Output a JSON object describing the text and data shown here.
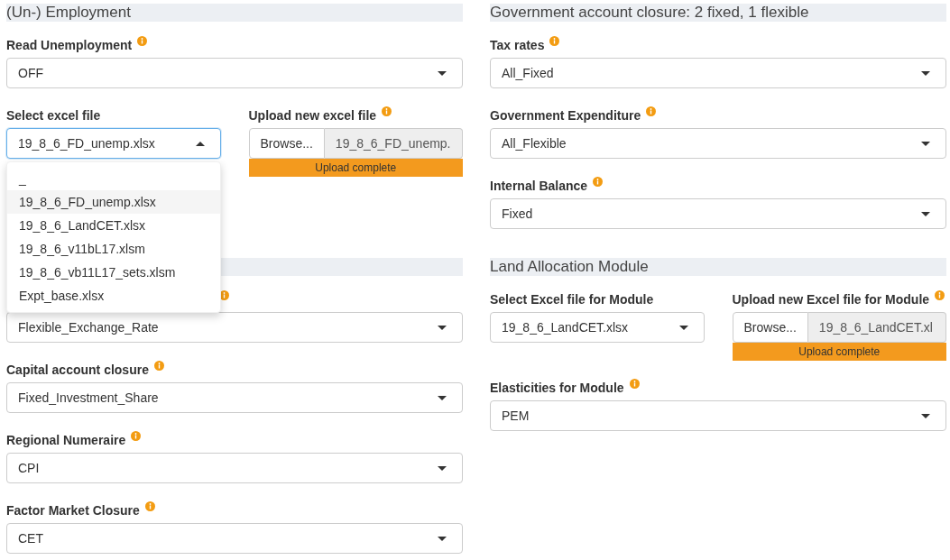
{
  "columns": [
    {
      "sections": [
        {
          "title": "(Un-) Employment",
          "rows": [
            [
              {
                "kind": "select",
                "label": "Read Unemployment",
                "info": true,
                "value": "OFF",
                "open": false
              }
            ],
            [
              {
                "kind": "select",
                "label": "Select excel file",
                "info": false,
                "value": "19_8_6_FD_unemp.xlsx",
                "open": true,
                "options": [
                  {
                    "label": "_",
                    "selected": false
                  },
                  {
                    "label": "19_8_6_FD_unemp.xlsx",
                    "selected": true
                  },
                  {
                    "label": "19_8_6_LandCET.xlsx",
                    "selected": false
                  },
                  {
                    "label": "19_8_6_v11bL17.xlsm",
                    "selected": false
                  },
                  {
                    "label": "19_8_6_vb11L17_sets.xlsm",
                    "selected": false
                  },
                  {
                    "label": "Expt_base.xlsx",
                    "selected": false
                  }
                ]
              },
              {
                "kind": "upload",
                "label": "Upload new excel file",
                "info": true,
                "button": "Browse...",
                "filename": "19_8_6_FD_unemp.",
                "progress": {
                  "level": 1,
                  "text": "Upload complete"
                }
              }
            ]
          ]
        },
        {
          "rows": [
            [
              {
                "kind": "select",
                "info": true,
                "value": "Flexible_Exchange_Rate",
                "open": false
              }
            ],
            [
              {
                "kind": "select",
                "label": "Capital account closure",
                "info": true,
                "value": "Fixed_Investment_Share",
                "open": false
              }
            ],
            [
              {
                "kind": "select",
                "label": "Regional Numeraire",
                "info": true,
                "value": "CPI",
                "open": false
              }
            ],
            [
              {
                "kind": "select",
                "label": "Factor Market Closure",
                "info": true,
                "value": "CET",
                "open": false
              }
            ]
          ]
        }
      ]
    },
    {
      "sections": [
        {
          "title": "Government account closure: 2 fixed, 1 flexible",
          "rows": [
            [
              {
                "kind": "select",
                "label": "Tax rates",
                "info": true,
                "value": "All_Fixed",
                "open": false
              }
            ],
            [
              {
                "kind": "select",
                "label": "Government Expenditure",
                "info": true,
                "value": "All_Flexible",
                "open": false
              }
            ],
            [
              {
                "kind": "select",
                "label": "Internal Balance",
                "info": true,
                "value": "Fixed",
                "open": false
              }
            ]
          ]
        },
        {
          "title": "Land Allocation Module",
          "rows": [
            [
              {
                "kind": "select",
                "label": "Select Excel file for Module",
                "info": false,
                "value": "19_8_6_LandCET.xlsx",
                "open": false
              },
              {
                "kind": "upload",
                "label": "Upload new Excel file for Module",
                "info": true,
                "button": "Browse...",
                "filename": "19_8_6_LandCET.xl",
                "progress": {
                  "level": 1,
                  "text": "Upload complete"
                }
              }
            ],
            [
              {
                "kind": "select",
                "label": "Elasticities for Module",
                "info": true,
                "value": "PEM",
                "open": false
              }
            ]
          ]
        }
      ]
    }
  ]
}
